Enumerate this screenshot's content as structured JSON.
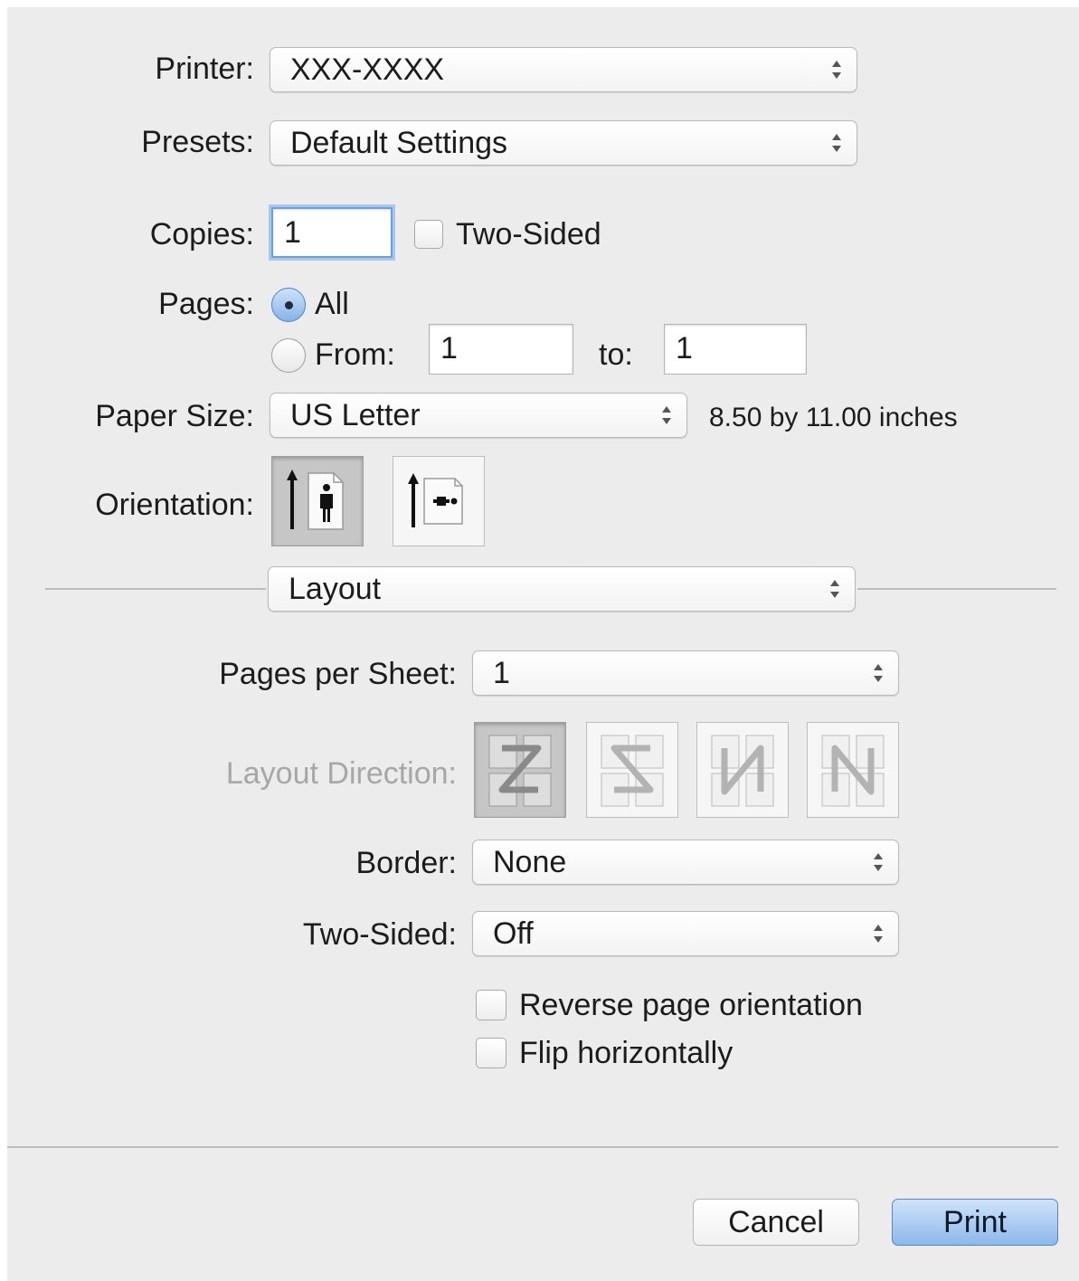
{
  "printer": {
    "label": "Printer:",
    "value": "XXX-XXXX"
  },
  "presets": {
    "label": "Presets:",
    "value": "Default Settings"
  },
  "copies": {
    "label": "Copies:",
    "value": "1",
    "two_sided_label": "Two-Sided",
    "two_sided_checked": false
  },
  "pages": {
    "label": "Pages:",
    "all_label": "All",
    "from_label": "From:",
    "to_label": "to:",
    "from_value": "1",
    "to_value": "1",
    "selected": "All"
  },
  "paper_size": {
    "label": "Paper Size:",
    "value": "US Letter",
    "dimensions": "8.50 by 11.00 inches"
  },
  "orientation": {
    "label": "Orientation:",
    "options": [
      "portrait-icon",
      "landscape-icon"
    ],
    "selected": "portrait"
  },
  "section": {
    "value": "Layout"
  },
  "pages_per_sheet": {
    "label": "Pages per Sheet:",
    "value": "1"
  },
  "layout_direction": {
    "label": "Layout Direction:",
    "options": [
      "z-direction-icon",
      "reverse-z-direction-icon",
      "n-reverse-direction-icon",
      "n-direction-icon"
    ],
    "selected": 0
  },
  "border": {
    "label": "Border:",
    "value": "None"
  },
  "two_sided": {
    "label": "Two-Sided:",
    "value": "Off"
  },
  "reverse_page_orientation": {
    "label": "Reverse page orientation",
    "checked": false
  },
  "flip_horizontally": {
    "label": "Flip horizontally",
    "checked": false
  },
  "buttons": {
    "cancel": "Cancel",
    "print": "Print"
  }
}
